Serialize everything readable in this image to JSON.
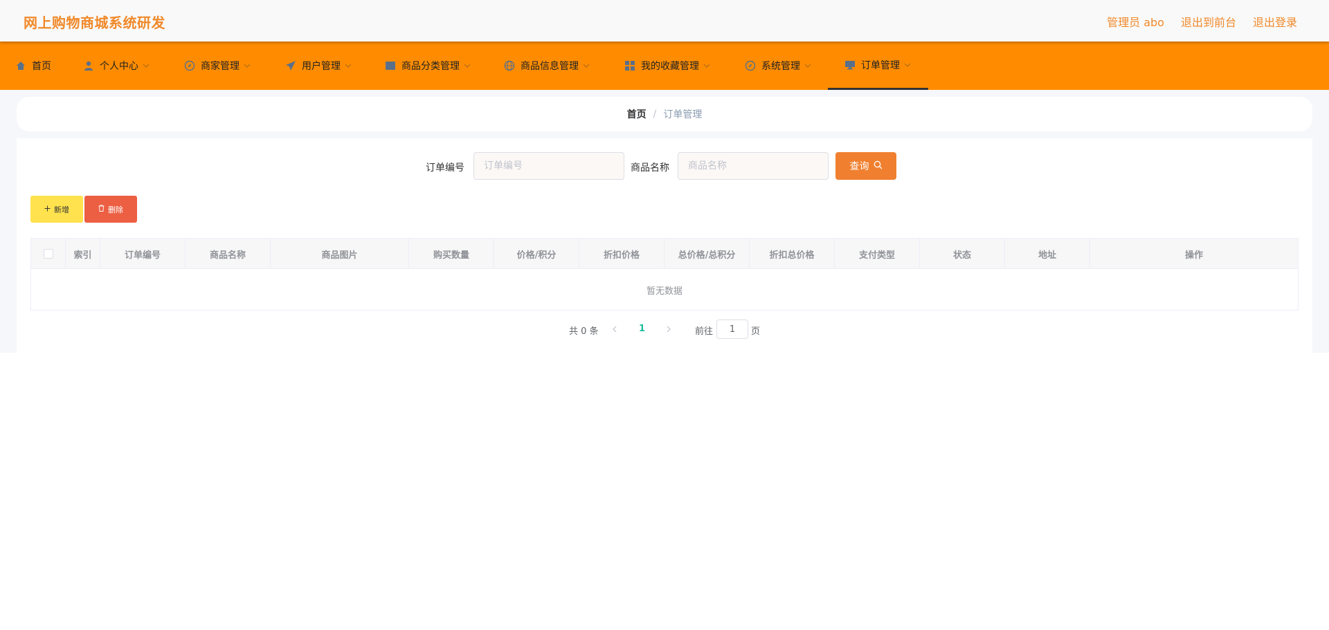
{
  "header": {
    "title": "网上购物商城系统研发",
    "links": [
      "管理员 abo",
      "退出到前台",
      "退出登录"
    ]
  },
  "nav": {
    "items": [
      {
        "label": "首页",
        "icon": "home-icon",
        "has_menu": false
      },
      {
        "label": "个人中心",
        "icon": "user-icon",
        "has_menu": true
      },
      {
        "label": "商家管理",
        "icon": "compass-icon",
        "has_menu": true
      },
      {
        "label": "用户管理",
        "icon": "send-icon",
        "has_menu": true
      },
      {
        "label": "商品分类管理",
        "icon": "folder-icon",
        "has_menu": true
      },
      {
        "label": "商品信息管理",
        "icon": "globe-icon",
        "has_menu": true
      },
      {
        "label": "我的收藏管理",
        "icon": "grid-icon",
        "has_menu": true
      },
      {
        "label": "系统管理",
        "icon": "compass-icon",
        "has_menu": true
      },
      {
        "label": "订单管理",
        "icon": "monitor-icon",
        "has_menu": true,
        "active": true
      }
    ]
  },
  "breadcrumb": {
    "home": "首页",
    "separator": "/",
    "current": "订单管理"
  },
  "search": {
    "order_no_label": "订单编号",
    "order_no_placeholder": "订单编号",
    "goods_name_label": "商品名称",
    "goods_name_placeholder": "商品名称",
    "query_label": "查询"
  },
  "actions": {
    "add_label": "新增",
    "delete_label": "删除"
  },
  "table": {
    "columns": [
      "索引",
      "订单编号",
      "商品名称",
      "商品图片",
      "购买数量",
      "价格/积分",
      "折扣价格",
      "总价格/总积分",
      "折扣总价格",
      "支付类型",
      "状态",
      "地址",
      "操作"
    ],
    "empty_text": "暂无数据"
  },
  "pagination": {
    "total_text": "共 0 条",
    "current_page": "1",
    "goto_label": "前往",
    "goto_value": "1",
    "page_suffix": "页"
  },
  "colors": {
    "brand": "#f0892a",
    "nav_bg": "#ff8c00",
    "query_button": "#f0802f",
    "add_button": "#ffe24d",
    "delete_button": "#ec5f43",
    "active_page": "#1abc9c"
  }
}
